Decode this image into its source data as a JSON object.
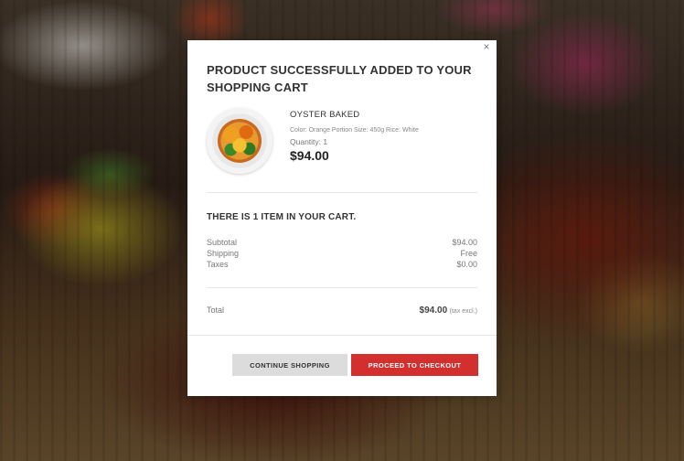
{
  "modal": {
    "close_symbol": "×",
    "title": "PRODUCT SUCCESSFULLY ADDED TO YOUR SHOPPING CART",
    "product": {
      "name": "OYSTER BAKED",
      "attributes": "Color: Orange Portion Size: 450g Rice: White",
      "quantity": "Quantity: 1",
      "price": "$94.00",
      "image_icon": "food-plate-image"
    },
    "cart_count": "THERE IS 1 ITEM IN YOUR CART.",
    "summary": {
      "subtotal_label": "Subtotal",
      "subtotal_value": "$94.00",
      "shipping_label": "Shipping",
      "shipping_value": "Free",
      "taxes_label": "Taxes",
      "taxes_value": "$0.00",
      "total_label": "Total",
      "total_value": "$94.00",
      "total_note": "(tax excl.)"
    },
    "buttons": {
      "continue": "CONTINUE SHOPPING",
      "checkout": "PROCEED TO CHECKOUT"
    }
  },
  "colors": {
    "checkout_button": "#d32f2f",
    "continue_button": "#dcdcdc",
    "overlay": "rgba(0,0,0,0.35)"
  }
}
